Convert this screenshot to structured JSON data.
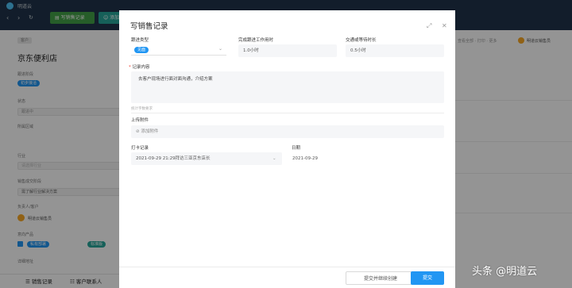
{
  "header": {
    "logo_text": "明道云",
    "logo_icon": "app-logo-icon",
    "add_sales_record_label": "写销售记录",
    "add_contact_label": "添加联系人"
  },
  "left_panel": {
    "company_tag": "客户",
    "company_name": "京东便利店",
    "follow_stage_label": "跟进阶段",
    "follow_stage_value": "初步接洽",
    "status_label": "状态",
    "status_value": "跟进中",
    "region_label": "所属区域",
    "industry_label": "行业",
    "industry_placeholder": "请选择行业",
    "budget_label": "销售成交阶段",
    "budget_value": "需了解行业解决方案",
    "owner_label": "负责人/客户",
    "owner_name": "明道云销售员",
    "product_label": "意向产品",
    "product_value_1": "私有部署",
    "product_value_2": "标准版",
    "address_label": "详细地址"
  },
  "right_panel": {
    "toolbar_text": "查看全部 · 打印 · 更多",
    "user_name": "明道云销售员"
  },
  "bottom_tabs": [
    {
      "label": "销售记录",
      "icon": "list-icon"
    },
    {
      "label": "客户联系人",
      "icon": "contacts-icon"
    }
  ],
  "modal": {
    "title": "写销售记录",
    "expand_icon": "expand-icon",
    "close_icon": "close-icon",
    "follow_type_label": "跟进类型",
    "follow_type_value": "见面",
    "work_hours_label": "完成跟进工作用时",
    "work_hours_value": "1.0小时",
    "traffic_time_label": "交通或等待时长",
    "traffic_time_value": "0.5小时",
    "content_label": "记录内容",
    "content_value": "去客户现场进行面对面沟通，介绍方案",
    "content_hint": "统计字数要求",
    "attachment_label": "上传附件",
    "attachment_button": "添加附件",
    "checkin_label": "打卡记录",
    "checkin_value": "2021-09-29 21:29拜访三亚京东店长",
    "date_label": "日期",
    "date_value": "2021-09-29",
    "submit_continue_label": "提交并继续创建",
    "submit_label": "提交"
  },
  "watermark": {
    "text": "头条 @明道云"
  },
  "colors": {
    "topbar": "#20324a",
    "primary": "#2196f3",
    "green_button": "#4caf50",
    "teal_button": "#26a69a"
  }
}
